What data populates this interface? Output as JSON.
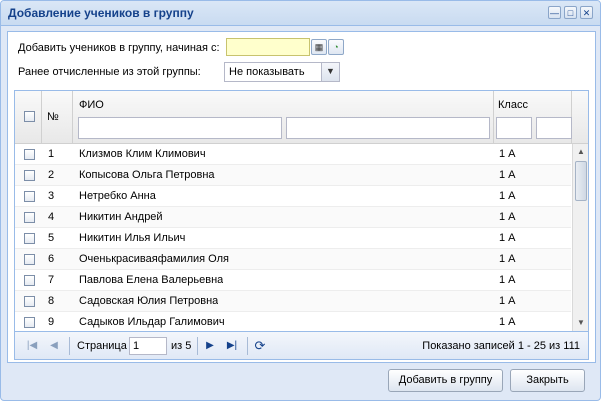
{
  "window": {
    "title": "Добавление учеников в группу"
  },
  "filters": {
    "add_from_label": "Добавить учеников в группу, начиная с:",
    "add_from_value": "",
    "expelled_label": "Ранее отчисленные из этой группы:",
    "expelled_value": "Не показывать"
  },
  "grid": {
    "columns": {
      "num": "№",
      "fio": "ФИО",
      "class": "Класс"
    },
    "rows": [
      {
        "num": "1",
        "fio": "Клизмов Клим Климович",
        "class": "1 А"
      },
      {
        "num": "2",
        "fio": "Копысова Ольга Петровна",
        "class": "1 А"
      },
      {
        "num": "3",
        "fio": "Нетребко Анна",
        "class": "1 А"
      },
      {
        "num": "4",
        "fio": "Никитин Андрей",
        "class": "1 А"
      },
      {
        "num": "5",
        "fio": "Никитин Илья Ильич",
        "class": "1 А"
      },
      {
        "num": "6",
        "fio": "Оченькрасиваяфамилия Оля",
        "class": "1 А"
      },
      {
        "num": "7",
        "fio": "Павлова Елена Валерьевна",
        "class": "1 А"
      },
      {
        "num": "8",
        "fio": "Садовская Юлия Петровна",
        "class": "1 А"
      },
      {
        "num": "9",
        "fio": "Садыков Ильдар Галимович",
        "class": "1 А"
      }
    ]
  },
  "pager": {
    "page_label": "Страница",
    "page_value": "1",
    "of_label": "из 5",
    "summary": "Показано записей 1 - 25 из 111"
  },
  "buttons": {
    "add": "Добавить в группу",
    "close": "Закрыть"
  },
  "colors": {
    "accent": "#15428b",
    "frame": "#99bbe8",
    "highlight_field": "#ffffcc"
  }
}
